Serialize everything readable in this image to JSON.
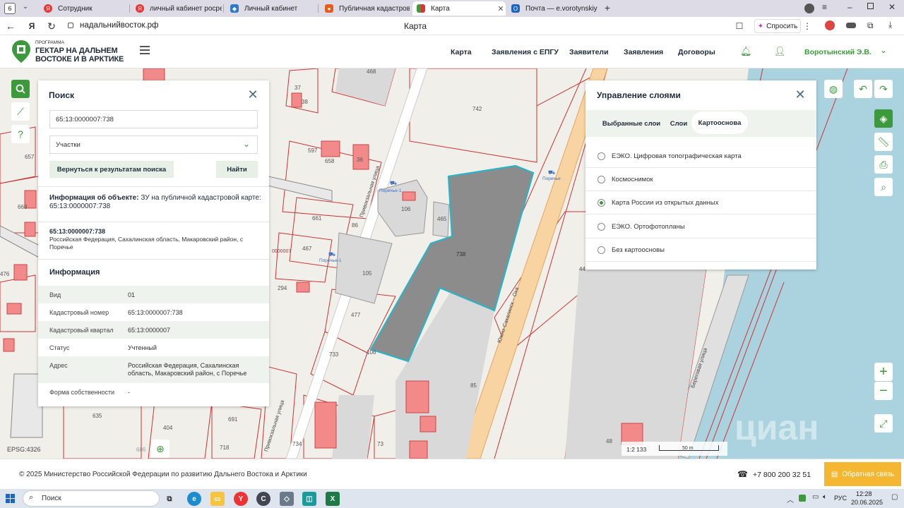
{
  "browser": {
    "tab_count": "6",
    "tabs": [
      {
        "label": "Сотрудник",
        "icon": "yandex-icon",
        "color": "#e33"
      },
      {
        "label": "личный кабинет росреест",
        "icon": "yandex-icon",
        "color": "#e33"
      },
      {
        "label": "Личный кабинет",
        "icon": "rosreestr-icon",
        "color": "#2a7ac7"
      },
      {
        "label": "Публичная кадастровая",
        "icon": "pkk-icon",
        "color": "#e65c1a"
      },
      {
        "label": "Карта",
        "icon": "site-icon",
        "color": "#3c9a3c"
      },
      {
        "label": "Почта — e.vorotynskiy@",
        "icon": "outlook-icon",
        "color": "#1a66c2"
      }
    ],
    "address": "надальнийвосток.рф",
    "page_title": "Карта",
    "ask_label": "Спросить"
  },
  "site": {
    "logo_small": "ПРОГРАММА",
    "logo_line1": "ГЕКТАР НА ДАЛЬНЕМ",
    "logo_line2": "ВОСТОКЕ И В АРКТИКЕ",
    "nav": [
      "Карта",
      "Заявления с ЕПГУ",
      "Заявители",
      "Заявления",
      "Договоры"
    ],
    "user_name": "Воротынский Э.В."
  },
  "search_panel": {
    "title": "Поиск",
    "query": "65:13:0000007:738",
    "select_value": "Участки",
    "back_button": "Вернуться к результатам поиска",
    "find_button": "Найти",
    "object_info_label": "Информация об объекте:",
    "object_info_value": "ЗУ на публичной кадастровой карте: 65:13:0000007:738",
    "object_number": "65:13:0000007:738",
    "object_address": "Российская Федерация, Сахалинская область, Макаровский район, с Поречье",
    "info_heading": "Информация",
    "fields": [
      {
        "key": "Вид",
        "value": "01"
      },
      {
        "key": "Кадастровый номер",
        "value": "65:13:0000007:738"
      },
      {
        "key": "Кадастровый квартал",
        "value": "65:13:0000007"
      },
      {
        "key": "Статус",
        "value": "Учтенный"
      },
      {
        "key": "Адрес",
        "value": "Российская Федерация, Сахалинская область, Макаровский район, с Поречье"
      },
      {
        "key": "Форма собственности",
        "value": "-"
      }
    ]
  },
  "layers_panel": {
    "title": "Управление слоями",
    "tabs": [
      "Выбранные слои",
      "Слои",
      "Картооснова"
    ],
    "active_tab": "Картооснова",
    "options": [
      {
        "label": "ЕЭКО. Цифровая топографическая карта",
        "selected": false
      },
      {
        "label": "Космоснимок",
        "selected": false
      },
      {
        "label": "Карта России из открытых данных",
        "selected": true
      },
      {
        "label": "ЕЭКО. Ортофотопланы",
        "selected": false
      },
      {
        "label": "Без картоосновы",
        "selected": false
      }
    ]
  },
  "map": {
    "parcel_labels": [
      "468",
      "742",
      "37",
      "38",
      "597",
      "658",
      "36",
      "106",
      "465",
      "738",
      "661",
      "86",
      "467",
      "105",
      "294",
      "477",
      "733",
      "106",
      "85",
      "635",
      "404",
      "691",
      "718",
      "734",
      "73",
      "48",
      "44",
      "657",
      "668",
      "476",
      "686"
    ],
    "street_labels": [
      "Привокзальная улица",
      "Южно-Сахалинск – Оха",
      "Береговая улица",
      "Привокзальная улица"
    ],
    "stop_labels": [
      "Поречье-1",
      "Поречье",
      "Поречье-1"
    ],
    "cadastral_fragment": "0000007",
    "epsg": "EPSG:4326",
    "scale": "1:2 133",
    "scale_bar": "50 m",
    "watermark": "циан"
  },
  "footer": {
    "copyright": "© 2025 Министерство Российской Федерации по развитию Дальнего Востока и Арктики",
    "phone": "+7 800 200 32 51",
    "feedback": "Обратная связь"
  },
  "taskbar": {
    "search": "Поиск",
    "lang": "РУС",
    "time": "12:28",
    "date": "20.06.2025"
  }
}
